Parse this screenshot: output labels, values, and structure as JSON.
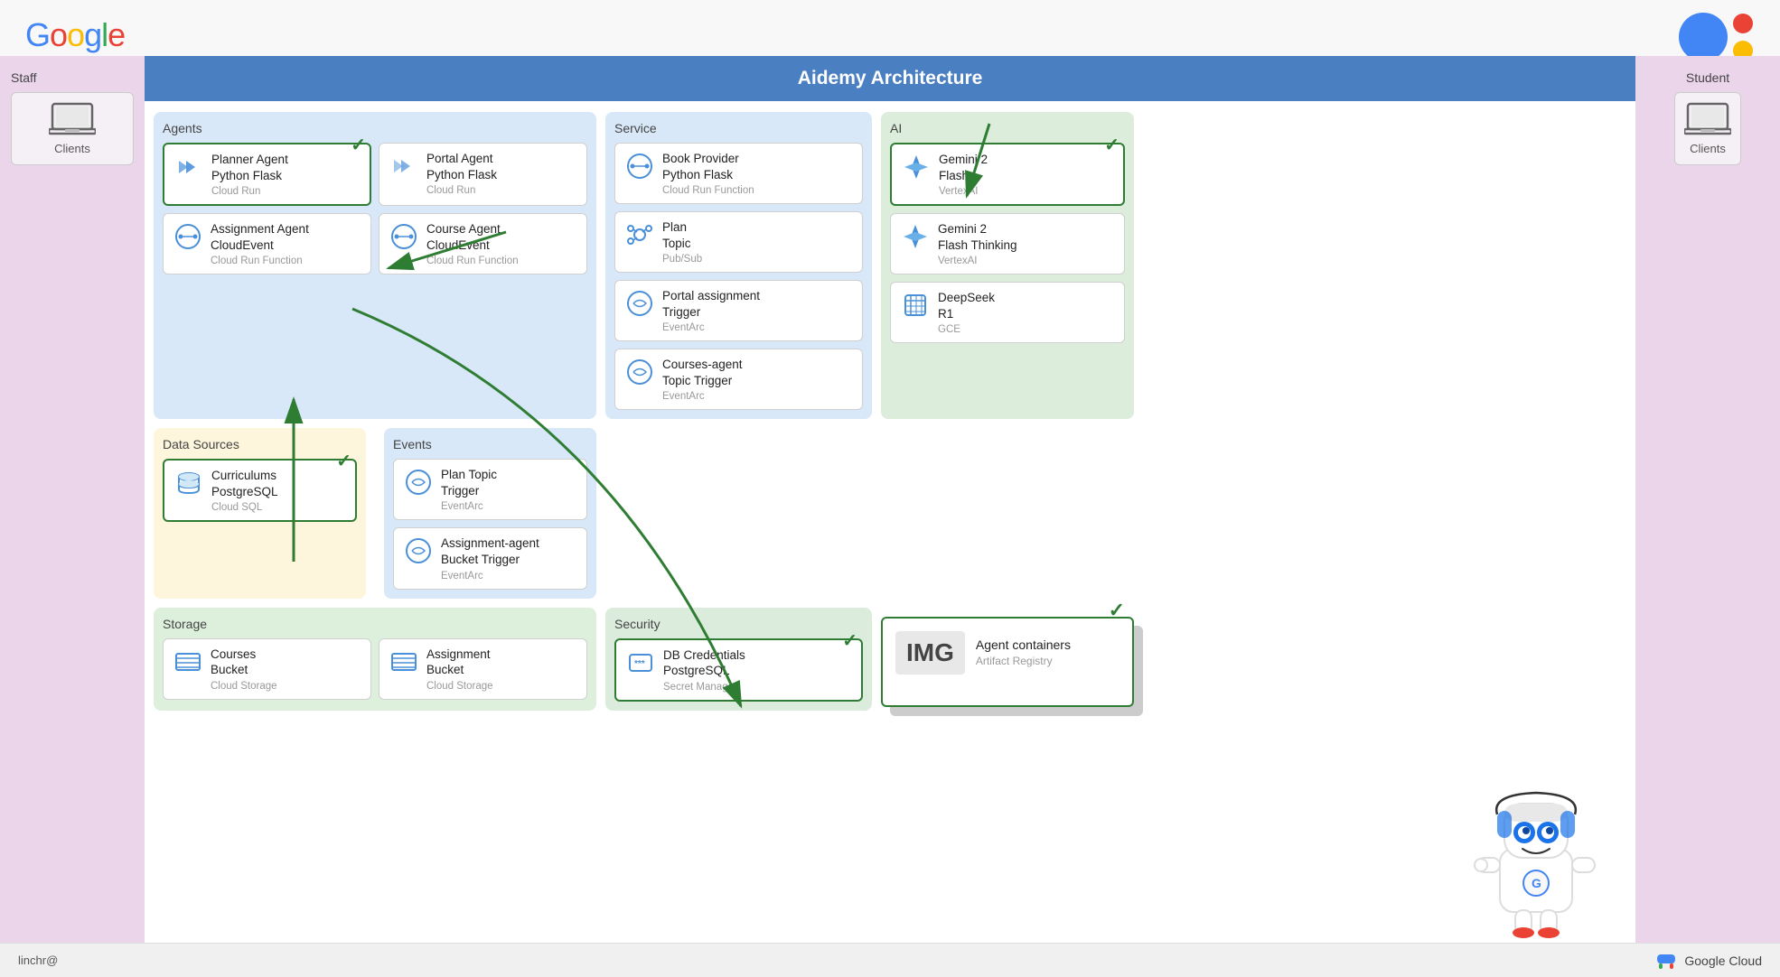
{
  "app": {
    "title": "Aidemy Architecture",
    "google_logo": "Google",
    "bottom_user": "linchr@",
    "google_cloud_label": "Google Cloud"
  },
  "left_panel": {
    "title": "Staff",
    "client_label": "Clients"
  },
  "right_panel": {
    "title": "Student",
    "client_label": "Clients"
  },
  "sections": {
    "agents": {
      "label": "Agents",
      "cards": [
        {
          "name": "Planner Agent\nPython Flask",
          "sub": "Cloud Run",
          "highlighted": true,
          "has_check": true,
          "icon": "cloud-run"
        },
        {
          "name": "Portal Agent\nPython Flask",
          "sub": "Cloud Run",
          "highlighted": false,
          "has_check": false,
          "icon": "cloud-run"
        },
        {
          "name": "Assignment Agent\nCloudEvent",
          "sub": "Cloud Run Function",
          "highlighted": false,
          "has_check": false,
          "icon": "cloud-run"
        },
        {
          "name": "Course Agent\nCloudEvent",
          "sub": "Cloud Run Function",
          "highlighted": false,
          "has_check": false,
          "icon": "cloud-run"
        }
      ]
    },
    "service": {
      "label": "Service",
      "cards": [
        {
          "name": "Book Provider\nPython Flask",
          "sub": "Cloud Run Function",
          "highlighted": false,
          "icon": "cloud-run"
        },
        {
          "name": "Plan\nTopic",
          "sub": "Pub/Sub",
          "highlighted": false,
          "icon": "pubsub"
        },
        {
          "name": "Portal assignment\nTrigger",
          "sub": "EventArc",
          "highlighted": false,
          "icon": "eventarc"
        },
        {
          "name": "Courses-agent\nTopic Trigger",
          "sub": "EventArc",
          "highlighted": false,
          "icon": "eventarc"
        }
      ]
    },
    "ai": {
      "label": "AI",
      "cards": [
        {
          "name": "Gemini 2\nFlash",
          "sub": "VertexAI",
          "highlighted": true,
          "has_check": true,
          "icon": "gemini"
        },
        {
          "name": "Gemini 2\nFlash Thinking",
          "sub": "VertexAI",
          "highlighted": false,
          "icon": "gemini"
        },
        {
          "name": "DeepSeek\nR1",
          "sub": "GCE",
          "highlighted": false,
          "icon": "deepseek"
        }
      ]
    },
    "datasources": {
      "label": "Data Sources",
      "cards": [
        {
          "name": "Curriculums\nPostgreSQL",
          "sub": "Cloud SQL",
          "highlighted": true,
          "has_check": true,
          "icon": "cloudsql"
        }
      ]
    },
    "events": {
      "label": "Events",
      "cards": [
        {
          "name": "Plan Topic\nTrigger",
          "sub": "EventArc",
          "highlighted": false,
          "icon": "eventarc"
        },
        {
          "name": "Assignment-agent\nBucket Trigger",
          "sub": "EventArc",
          "highlighted": false,
          "icon": "eventarc"
        }
      ]
    },
    "storage": {
      "label": "Storage",
      "cards": [
        {
          "name": "Courses\nBucket",
          "sub": "Cloud Storage",
          "highlighted": false,
          "icon": "storage"
        },
        {
          "name": "Assignment\nBucket",
          "sub": "Cloud Storage",
          "highlighted": false,
          "icon": "storage"
        }
      ]
    },
    "security": {
      "label": "Security",
      "cards": [
        {
          "name": "DB Credentials\nPostgreSQL",
          "sub": "Secret Manager",
          "highlighted": true,
          "has_check": true,
          "icon": "secret"
        }
      ]
    },
    "artifact": {
      "label": "Artifact Registry",
      "img_label": "IMG",
      "sub_name": "Agent containers",
      "sub_label": "Artifact Registry",
      "highlighted": true,
      "has_check": true
    }
  }
}
